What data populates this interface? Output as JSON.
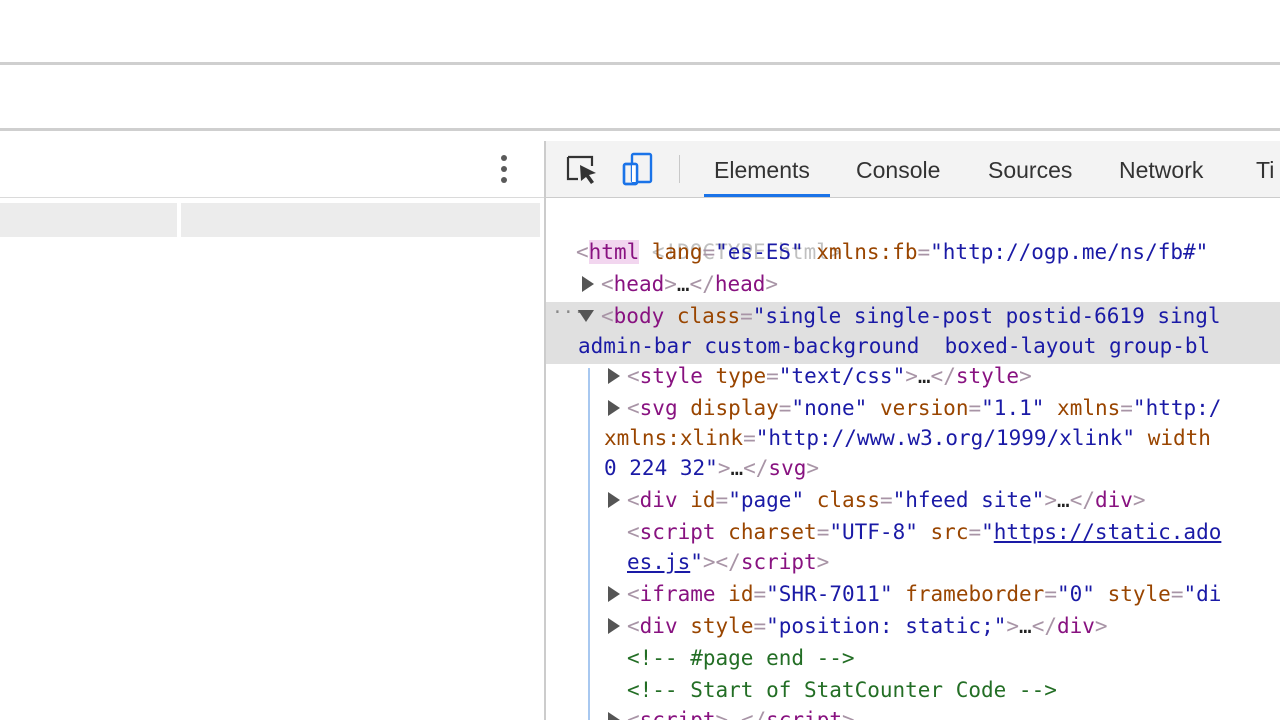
{
  "devtools": {
    "tabs": [
      {
        "label": "Elements",
        "active": true
      },
      {
        "label": "Console"
      },
      {
        "label": "Sources"
      },
      {
        "label": "Network"
      },
      {
        "label": "Ti"
      }
    ],
    "icons": [
      "inspect-element-icon",
      "device-toolbar-icon"
    ],
    "accent_color": "#1a73e8",
    "dom": {
      "doctype": "<!DOCTYPE html>",
      "html_open": {
        "tag": "html",
        "attr1": "lang",
        "val1": "es-ES",
        "attr2": "xmlns:fb",
        "val2": "http://ogp.me/ns/fb#"
      },
      "head": {
        "tag": "head",
        "ellipsis": "…"
      },
      "body_open": {
        "tag": "body",
        "attr": "class",
        "val_line1": "single single-post postid-6619 singl",
        "val_line2": "admin-bar custom-background  boxed-layout group-bl"
      },
      "style_node": {
        "tag": "style",
        "attr": "type",
        "val": "text/css"
      },
      "svg_node": {
        "tag": "svg",
        "attr1": "display",
        "val1": "none",
        "attr2": "version",
        "val2": "1.1",
        "attr3": "xmlns",
        "val3": "http:/",
        "line2_attr": "xmlns:xlink",
        "line2_val": "http://www.w3.org/1999/xlink",
        "line2_tail": "width",
        "line3_val_tail": "0 224 32"
      },
      "div_page": {
        "tag": "div",
        "attr1": "id",
        "val1": "page",
        "attr2": "class",
        "val2": "hfeed site"
      },
      "script_node": {
        "tag": "script",
        "attr1": "charset",
        "val1": "UTF-8",
        "attr2": "src",
        "link_line1": "https://static.ado",
        "link_line2": "es.js"
      },
      "iframe_node": {
        "tag": "iframe",
        "attr1": "id",
        "val1": "SHR-7011",
        "attr2": "frameborder",
        "val2": "0",
        "attr3": "style",
        "val3": "di"
      },
      "div_static": {
        "tag": "div",
        "attr": "style",
        "val": "position: static;"
      },
      "comment1": "<!-- #page end -->",
      "comment2": "<!-- Start of StatCounter Code -->",
      "script_last": {
        "tag": "script"
      }
    }
  }
}
